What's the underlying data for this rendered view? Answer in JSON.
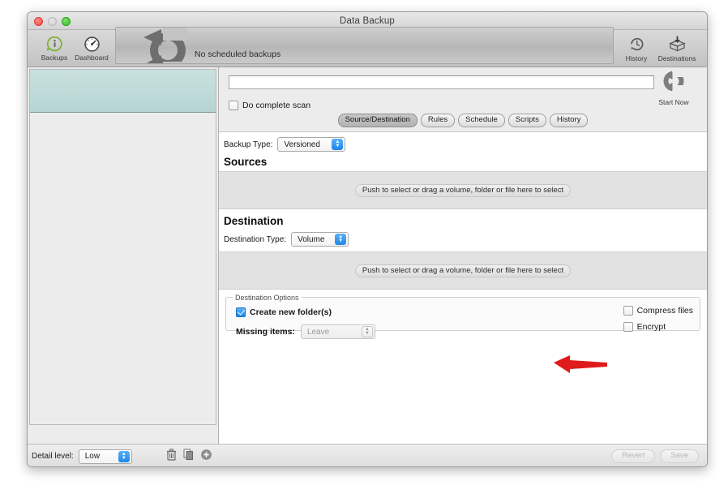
{
  "window": {
    "title": "Data Backup",
    "traffic_lights": [
      "close",
      "minimize",
      "zoom"
    ]
  },
  "toolbar": {
    "left_buttons": [
      {
        "label": "Backups",
        "icon": "info-badge-icon"
      },
      {
        "label": "Dashboard",
        "icon": "gauge-icon"
      }
    ],
    "right_buttons": [
      {
        "label": "History",
        "icon": "clock-icon"
      },
      {
        "label": "Destinations",
        "icon": "box-arrow-down-icon"
      }
    ],
    "status_text": "No scheduled backups",
    "status_logo": "circular-arrow-logo"
  },
  "start_now": {
    "label": "Start Now",
    "icon": "circular-arrow-icon"
  },
  "main": {
    "name_field": {
      "value": "",
      "placeholder": ""
    },
    "complete_scan": {
      "label": "Do complete scan",
      "checked": false
    },
    "tabs": [
      {
        "label": "Source/Destination",
        "active": true
      },
      {
        "label": "Rules",
        "active": false
      },
      {
        "label": "Schedule",
        "active": false
      },
      {
        "label": "Scripts",
        "active": false
      },
      {
        "label": "History",
        "active": false
      }
    ],
    "backup_type": {
      "label": "Backup Type:",
      "value": "Versioned"
    },
    "sources": {
      "heading": "Sources",
      "dropzone_text": "Push to select or drag a volume, folder or file here to select"
    },
    "destination": {
      "heading": "Destination",
      "type_label": "Destination Type:",
      "type_value": "Volume",
      "dropzone_text": "Push to select or drag a volume, folder or file here to select"
    },
    "destination_options": {
      "title": "Destination Options",
      "create_new_folders": {
        "label": "Create new folder(s)",
        "checked": true
      },
      "missing_items": {
        "label": "Missing items:",
        "value": "Leave",
        "disabled": true
      },
      "compress_files": {
        "label": "Compress files",
        "checked": false
      },
      "encrypt": {
        "label": "Encrypt",
        "checked": false
      }
    },
    "footer": {
      "revert_label": "Revert",
      "save_label": "Save",
      "disabled": true
    }
  },
  "sidebar": {
    "selected_item": {
      "label": "",
      "color": "#c9e1e0"
    },
    "detail_level": {
      "label": "Detail level:",
      "value": "Low"
    },
    "actions": [
      {
        "name": "delete",
        "icon": "trash-icon"
      },
      {
        "name": "duplicate",
        "icon": "duplicate-icon"
      },
      {
        "name": "add",
        "icon": "plus-circle-icon"
      }
    ]
  },
  "annotation": {
    "type": "red-arrow",
    "points_to": "Destination Type popup",
    "color": "#e01b1b"
  }
}
